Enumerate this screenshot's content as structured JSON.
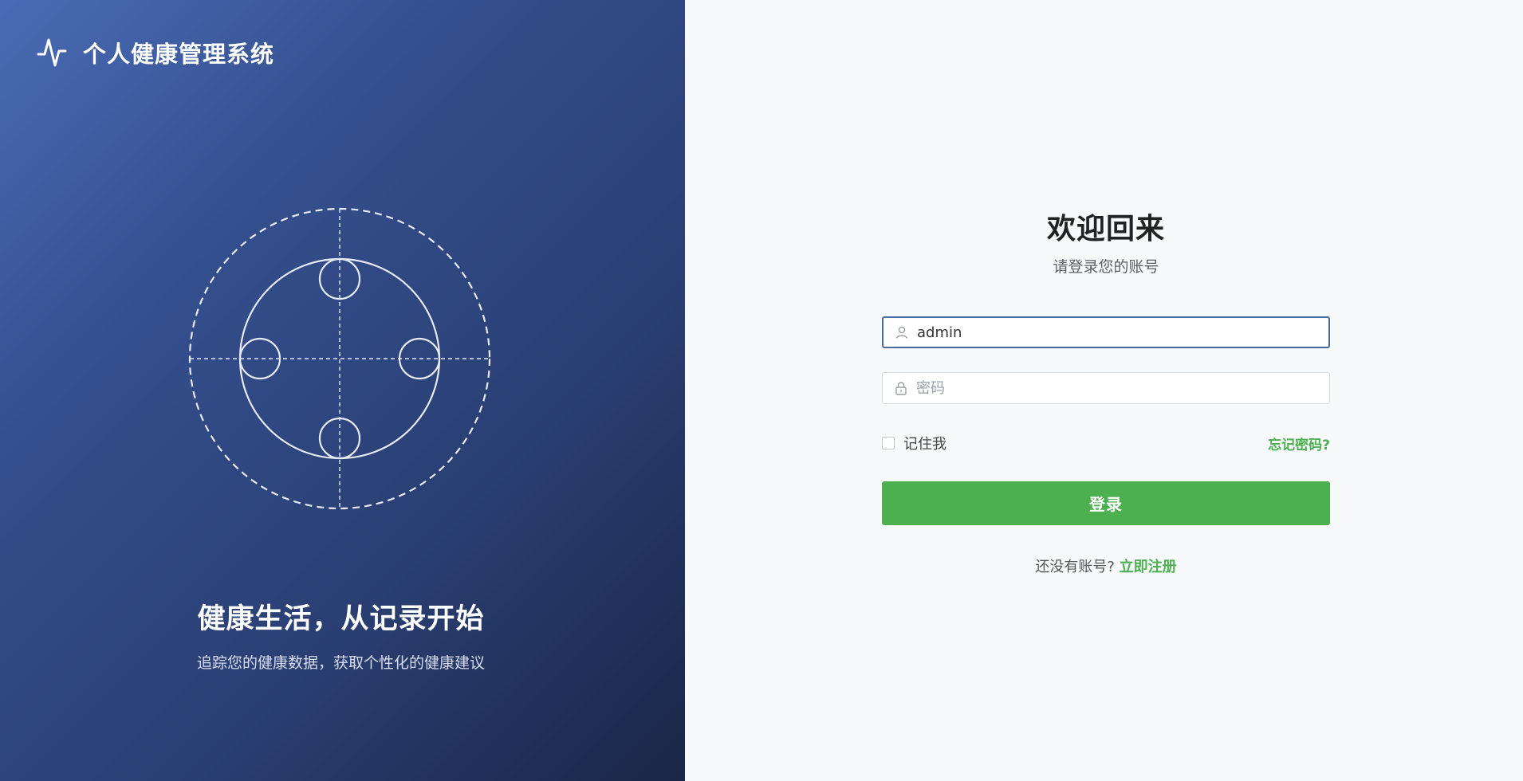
{
  "brand": {
    "name": "个人健康管理系统",
    "logo_icon": "heartbeat-pulse-icon"
  },
  "hero": {
    "tagline": "健康生活，从记录开始",
    "subtext": "追踪您的健康数据，获取个性化的健康建议"
  },
  "login": {
    "title": "欢迎回来",
    "subtitle": "请登录您的账号",
    "username": {
      "value": "admin",
      "icon": "user-icon"
    },
    "password": {
      "placeholder": "密码",
      "icon": "lock-icon"
    },
    "remember_label": "记住我",
    "forgot_label": "忘记密码?",
    "submit_label": "登录",
    "register_prompt": "还没有账号?",
    "register_link": "立即注册"
  },
  "colors": {
    "accent": "#4caf50",
    "left_gradient_start": "#4a6bb5",
    "left_gradient_end": "#1b2648",
    "focus_border": "#4a6a9f"
  }
}
